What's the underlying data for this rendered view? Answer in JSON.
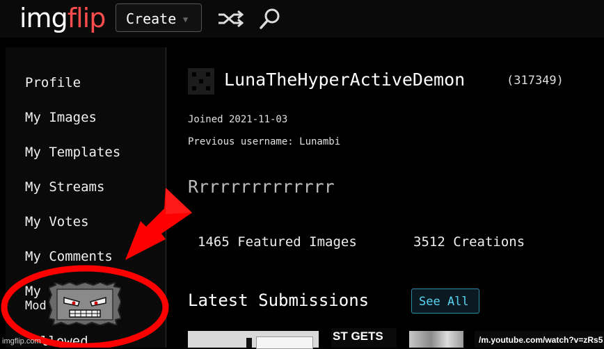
{
  "header": {
    "logo_img": "img",
    "logo_flip": "flip",
    "create_label": "Create",
    "shuffle_icon": "shuffle-icon",
    "search_icon": "search-icon"
  },
  "sidebar": {
    "items": [
      {
        "label": "Profile"
      },
      {
        "label": "My Images"
      },
      {
        "label": "My Templates"
      },
      {
        "label": "My Streams"
      },
      {
        "label": "My Votes"
      },
      {
        "label": "My Comments"
      },
      {
        "label": "My"
      },
      {
        "label": "Mod"
      },
      {
        "label": "llowed"
      }
    ]
  },
  "profile": {
    "username": "LunaTheHyperActiveDemon",
    "points": "(317349)",
    "joined": "Joined 2021-11-03",
    "previous_username": "Previous username: Lunambi",
    "bio": "Rrrrrrrrrrrrrr",
    "featured_images": "1465 Featured Images",
    "creations": "3512 Creations"
  },
  "submissions": {
    "heading": "Latest Submissions",
    "see_all_label": "See All",
    "thumb_caption_2": "ST GETS",
    "thumb_caption_4": "/m.youtube.com/watch?v=zRs5"
  },
  "overlay": {
    "watermark": "imgflip.com",
    "arrow_color": "#ff0000",
    "circle_color": "#ff0000"
  },
  "colors": {
    "accent_red": "#ff4d4d",
    "link_blue": "#5ad4f5"
  }
}
